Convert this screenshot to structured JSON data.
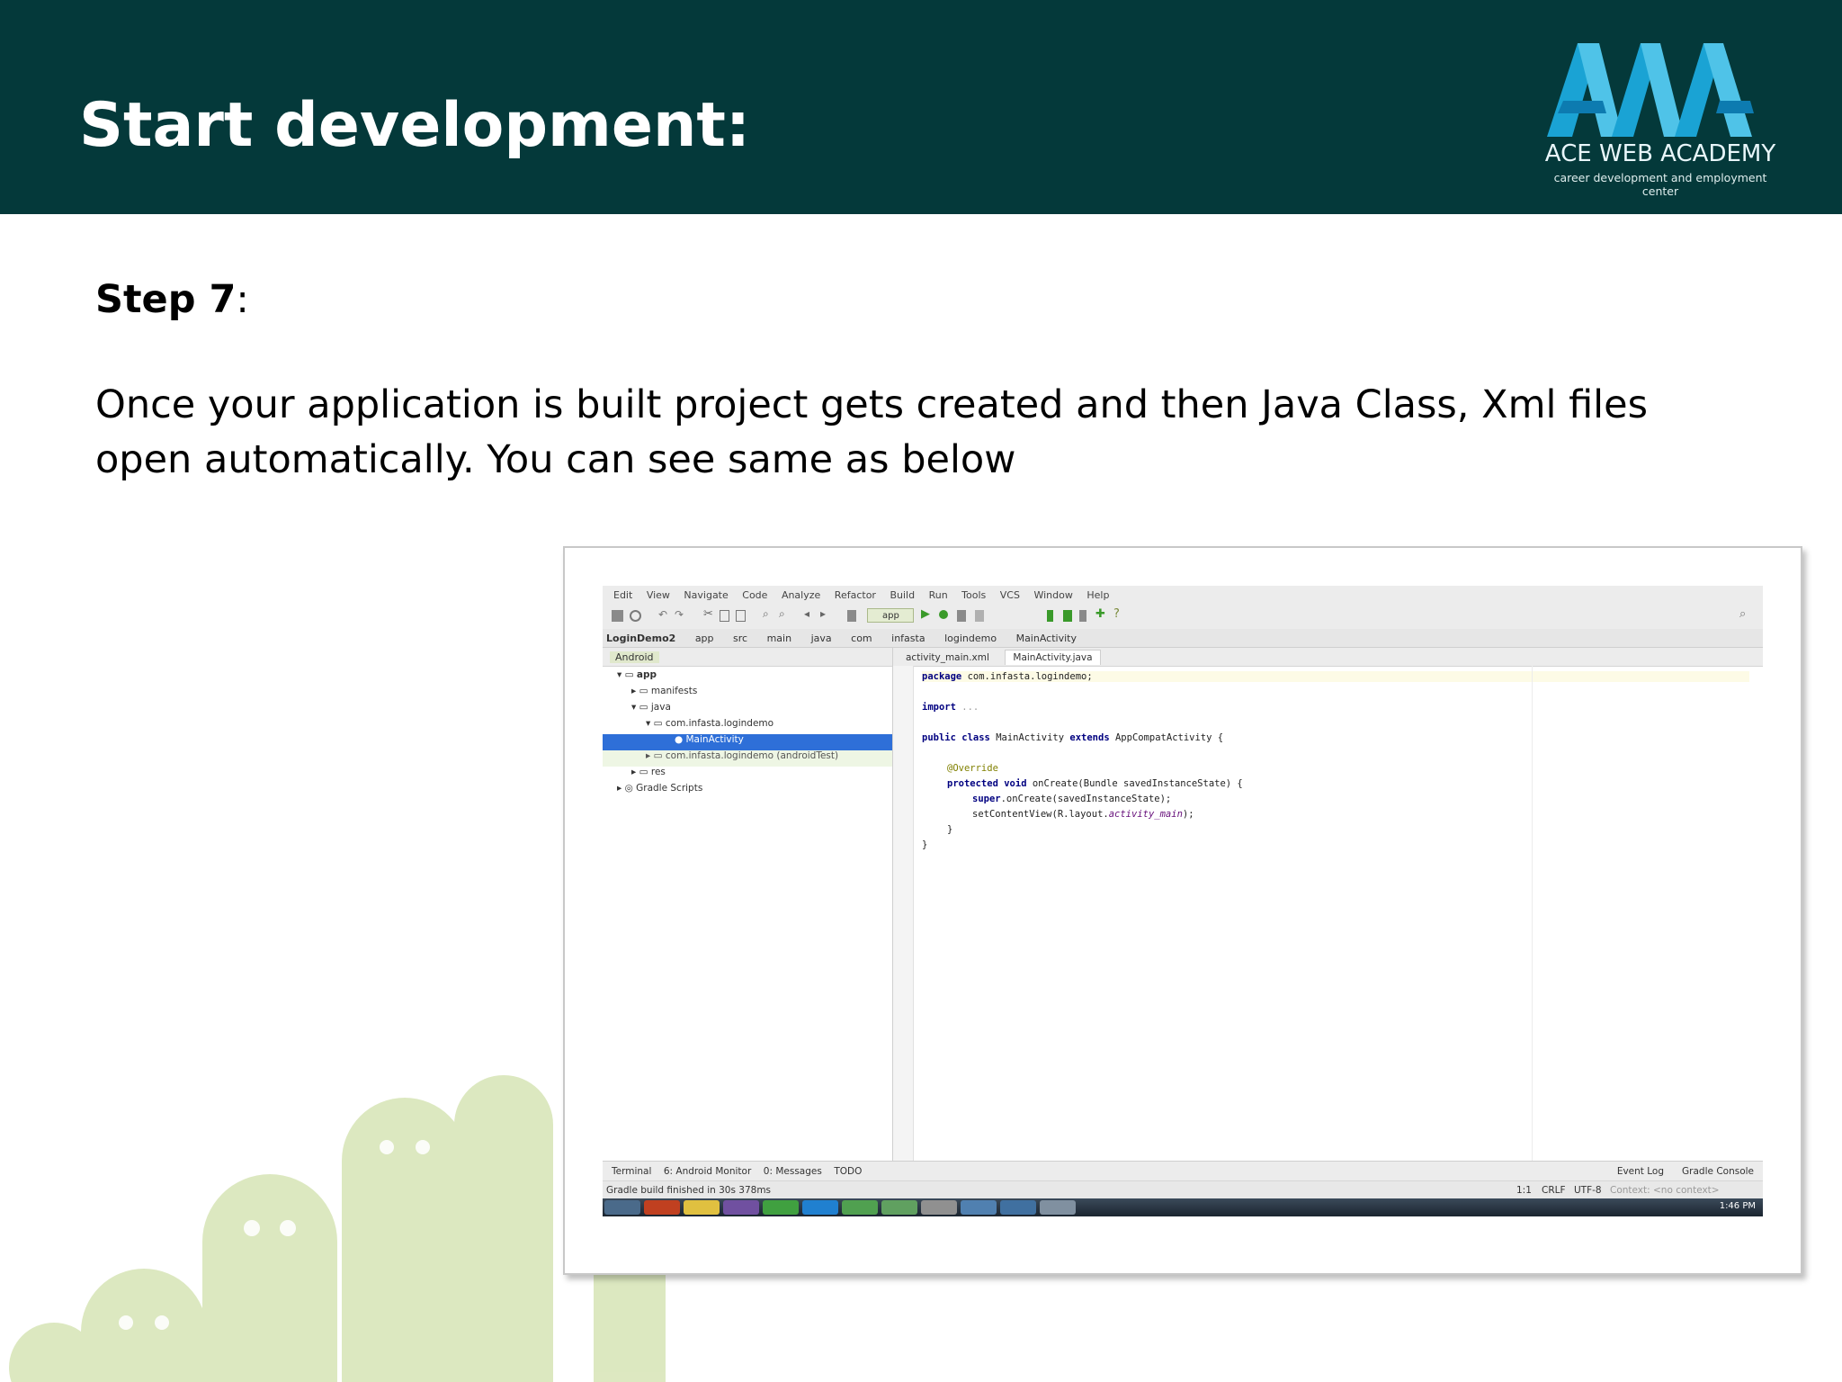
{
  "slide": {
    "title": "Start development:",
    "logo": {
      "name": "ACE WEB ACADEMY",
      "tagline": "career development and employment center",
      "colors": [
        "#1aa3d4",
        "#4fc3e8",
        "#0d7bb0"
      ]
    },
    "step_label": "Step 7",
    "step_suffix": ":",
    "body": "Once your application is built project gets created and then Java Class, Xml files open automatically. You can see same as below"
  },
  "ide": {
    "menu": [
      "Edit",
      "View",
      "Navigate",
      "Code",
      "Analyze",
      "Refactor",
      "Build",
      "Run",
      "Tools",
      "VCS",
      "Window",
      "Help"
    ],
    "run_config": "app",
    "breadcrumb": [
      "LoginDemo2",
      "app",
      "src",
      "main",
      "java",
      "com",
      "infasta",
      "logindemo",
      "MainActivity"
    ],
    "project_view": "Android",
    "tree": [
      {
        "label": "app",
        "indent": 1
      },
      {
        "label": "manifests",
        "indent": 2
      },
      {
        "label": "java",
        "indent": 2
      },
      {
        "label": "com.infasta.logindemo",
        "indent": 3
      },
      {
        "label": "MainActivity",
        "indent": 4,
        "selected": true
      },
      {
        "label": "com.infasta.logindemo (androidTest)",
        "indent": 3
      },
      {
        "label": "res",
        "indent": 2
      },
      {
        "label": "Gradle Scripts",
        "indent": 1
      }
    ],
    "tabs": [
      "activity_main.xml",
      "MainActivity.java"
    ],
    "code": {
      "line1": "com.infasta.logindemo;",
      "line2": "...",
      "line3": "MainActivity",
      "line3b": "AppCompatActivity {",
      "line4": "@Override",
      "line5": "onCreate(Bundle savedInstanceState) {",
      "line6": ".onCreate(savedInstanceState);",
      "line7": "setContentView(R.layout.",
      "line7b": "activity_main",
      "line7c": ");",
      "line8": "}",
      "line9": "}"
    },
    "keywords": {
      "package": "package",
      "import": "import",
      "public": "public",
      "class": "class",
      "extends": "extends",
      "protected": "protected",
      "void": "void",
      "super": "super"
    },
    "bottom_tools": [
      "Terminal",
      "6: Android Monitor",
      "0: Messages",
      "TODO"
    ],
    "bottom_tools_right": [
      "Event Log",
      "Gradle Console"
    ],
    "status_left": "Gradle build finished in 30s 378ms",
    "status_right": [
      "1:1",
      "CRLF",
      "UTF-8",
      "Context: <no context>"
    ],
    "clock": "1:46 PM"
  }
}
